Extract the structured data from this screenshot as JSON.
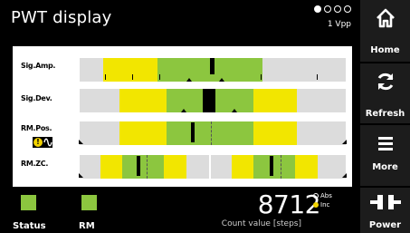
{
  "header": {
    "title": "PWT display",
    "signal_level": "1 Vpp",
    "page_indicator": {
      "current": 1,
      "total": 4
    }
  },
  "signals": [
    {
      "label": "Sig.Amp."
    },
    {
      "label": "Sig.Dev."
    },
    {
      "label": "RM.Pos."
    },
    {
      "label": "RM.ZC."
    }
  ],
  "status_icons": [
    "warning-icon",
    "sine-wave-icon"
  ],
  "footer": {
    "status_label": "Status",
    "rm_label": "RM",
    "count_value": "8712",
    "unit_abs": "Abs",
    "unit_inc": "Inc",
    "unit_selected": "Inc",
    "count_caption": "Count value [steps]"
  },
  "nav": {
    "home_label": "Home",
    "refresh_label": "Refresh",
    "more_label": "More",
    "power_label": "Power"
  },
  "colors": {
    "good": "#8cc63f",
    "warning": "#f2e600",
    "neutral": "#dcdcdc",
    "background": "#000000"
  }
}
